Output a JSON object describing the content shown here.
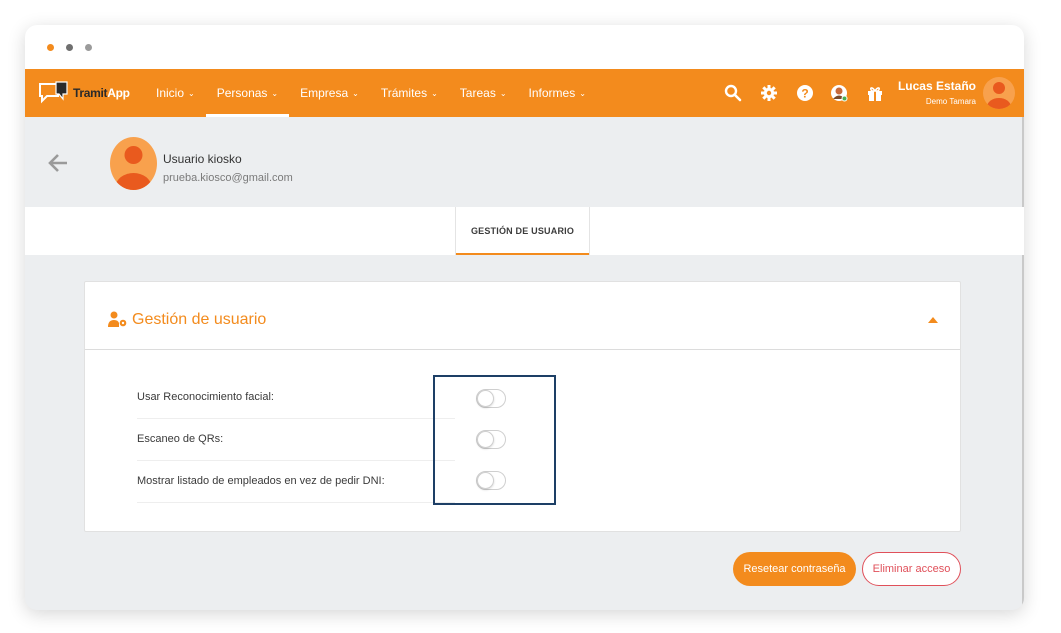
{
  "nav": {
    "brand_part1": "Tramit",
    "brand_part2": "App",
    "menu": [
      {
        "label": "Inicio",
        "active": false
      },
      {
        "label": "Personas",
        "active": true
      },
      {
        "label": "Empresa",
        "active": false
      },
      {
        "label": "Trámites",
        "active": false
      },
      {
        "label": "Tareas",
        "active": false
      },
      {
        "label": "Informes",
        "active": false
      }
    ],
    "icons": [
      "search-icon",
      "gear-icon",
      "help-icon",
      "notification-avatar-icon",
      "gift-icon"
    ],
    "user": {
      "name": "Lucas Estaño",
      "company": "Demo Tamara"
    }
  },
  "profile": {
    "name": "Usuario kiosko",
    "email": "prueba.kiosco@gmail.com"
  },
  "tabs": [
    {
      "label": "GESTIÓN DE USUARIO",
      "active": true
    }
  ],
  "card": {
    "title": "Gestión de usuario",
    "rows": [
      {
        "label": "Usar Reconocimiento facial:",
        "enabled": false
      },
      {
        "label": "Escaneo de QRs:",
        "enabled": false
      },
      {
        "label": "Mostrar listado de empleados en vez de pedir DNI:",
        "enabled": false
      }
    ]
  },
  "actions": {
    "reset_label": "Resetear contraseña",
    "delete_label": "Eliminar acceso"
  },
  "colors": {
    "accent": "#f38b1d",
    "danger": "#e0505a",
    "highlight": "#1d3f66"
  }
}
